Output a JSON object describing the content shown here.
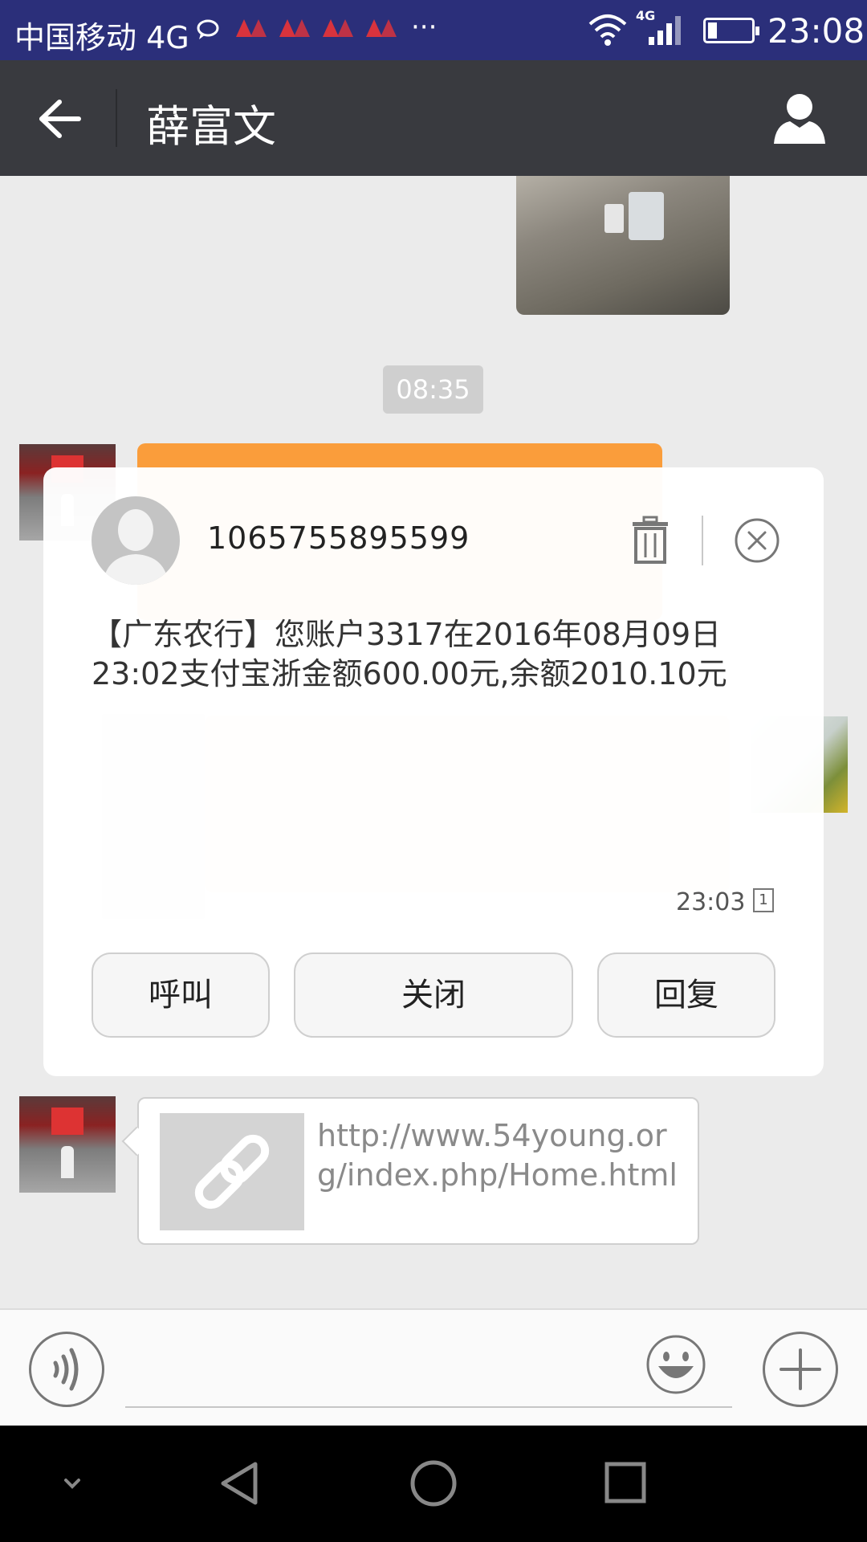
{
  "status_bar": {
    "carrier": "中国移动 4G",
    "more_dots": "···",
    "network": "4G",
    "time": "23:08"
  },
  "header": {
    "title": "薛富文"
  },
  "chat": {
    "timestamp": "08:35",
    "link_url": "http://www.54young.org/index.php/Home.html"
  },
  "sms_popup": {
    "sender": "1065755895599",
    "body": "【广东农行】您账户3317在2016年08月09日23:02支付宝浙金额600.00元,余额2010.10元",
    "time": "23:03",
    "sim_slot": "1",
    "buttons": {
      "call": "呼叫",
      "close": "关闭",
      "reply": "回复"
    }
  },
  "input_bar": {
    "placeholder": ""
  },
  "colors": {
    "status_bar": "#2b2f7a",
    "header": "#393a3f",
    "transfer_orange": "#fa9d3b",
    "chat_bg": "#ebebeb"
  }
}
